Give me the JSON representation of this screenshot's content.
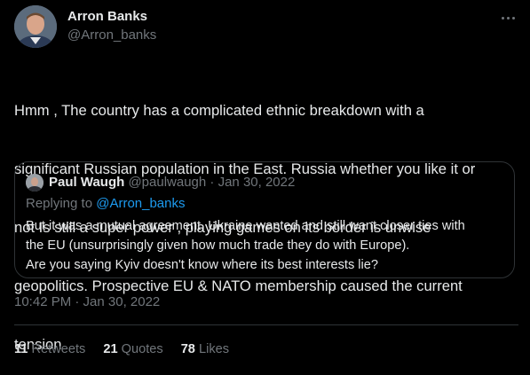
{
  "tweet": {
    "author": {
      "name": "Arron Banks",
      "handle": "@Arron_banks"
    },
    "text_lines": [
      "Hmm , The country has a complicated ethnic breakdown with a",
      "significant Russian population in the East. Russia whether you like it or",
      "not Is still a super power , playing games on its border is unwise",
      "geopolitics. Prospective EU & NATO membership caused the current",
      "tension"
    ],
    "timestamp": "10:42 PM · Jan 30, 2022",
    "stats": [
      {
        "count": "11",
        "label": "Retweets"
      },
      {
        "count": "21",
        "label": "Quotes"
      },
      {
        "count": "78",
        "label": "Likes"
      }
    ]
  },
  "quote": {
    "name": "Paul Waugh",
    "handle": "@paulwaugh",
    "separator": "·",
    "date": "Jan 30, 2022",
    "replying_prefix": "Replying to",
    "replying_to": "@Arron_banks",
    "body_lines": [
      "But it was a mutual agreement, Ukraine wanted and still want closer ties with",
      "the EU (unsurprisingly given how much trade they do with Europe).",
      "Are you saying Kyiv doesn't know where its best interests lie?"
    ]
  },
  "icons": {
    "more": "more-horizontal-icon"
  },
  "colors": {
    "background": "#000000",
    "text_primary": "#e7e9ea",
    "text_secondary": "#71767b",
    "link": "#1d9bf0",
    "border": "#2f3336"
  }
}
